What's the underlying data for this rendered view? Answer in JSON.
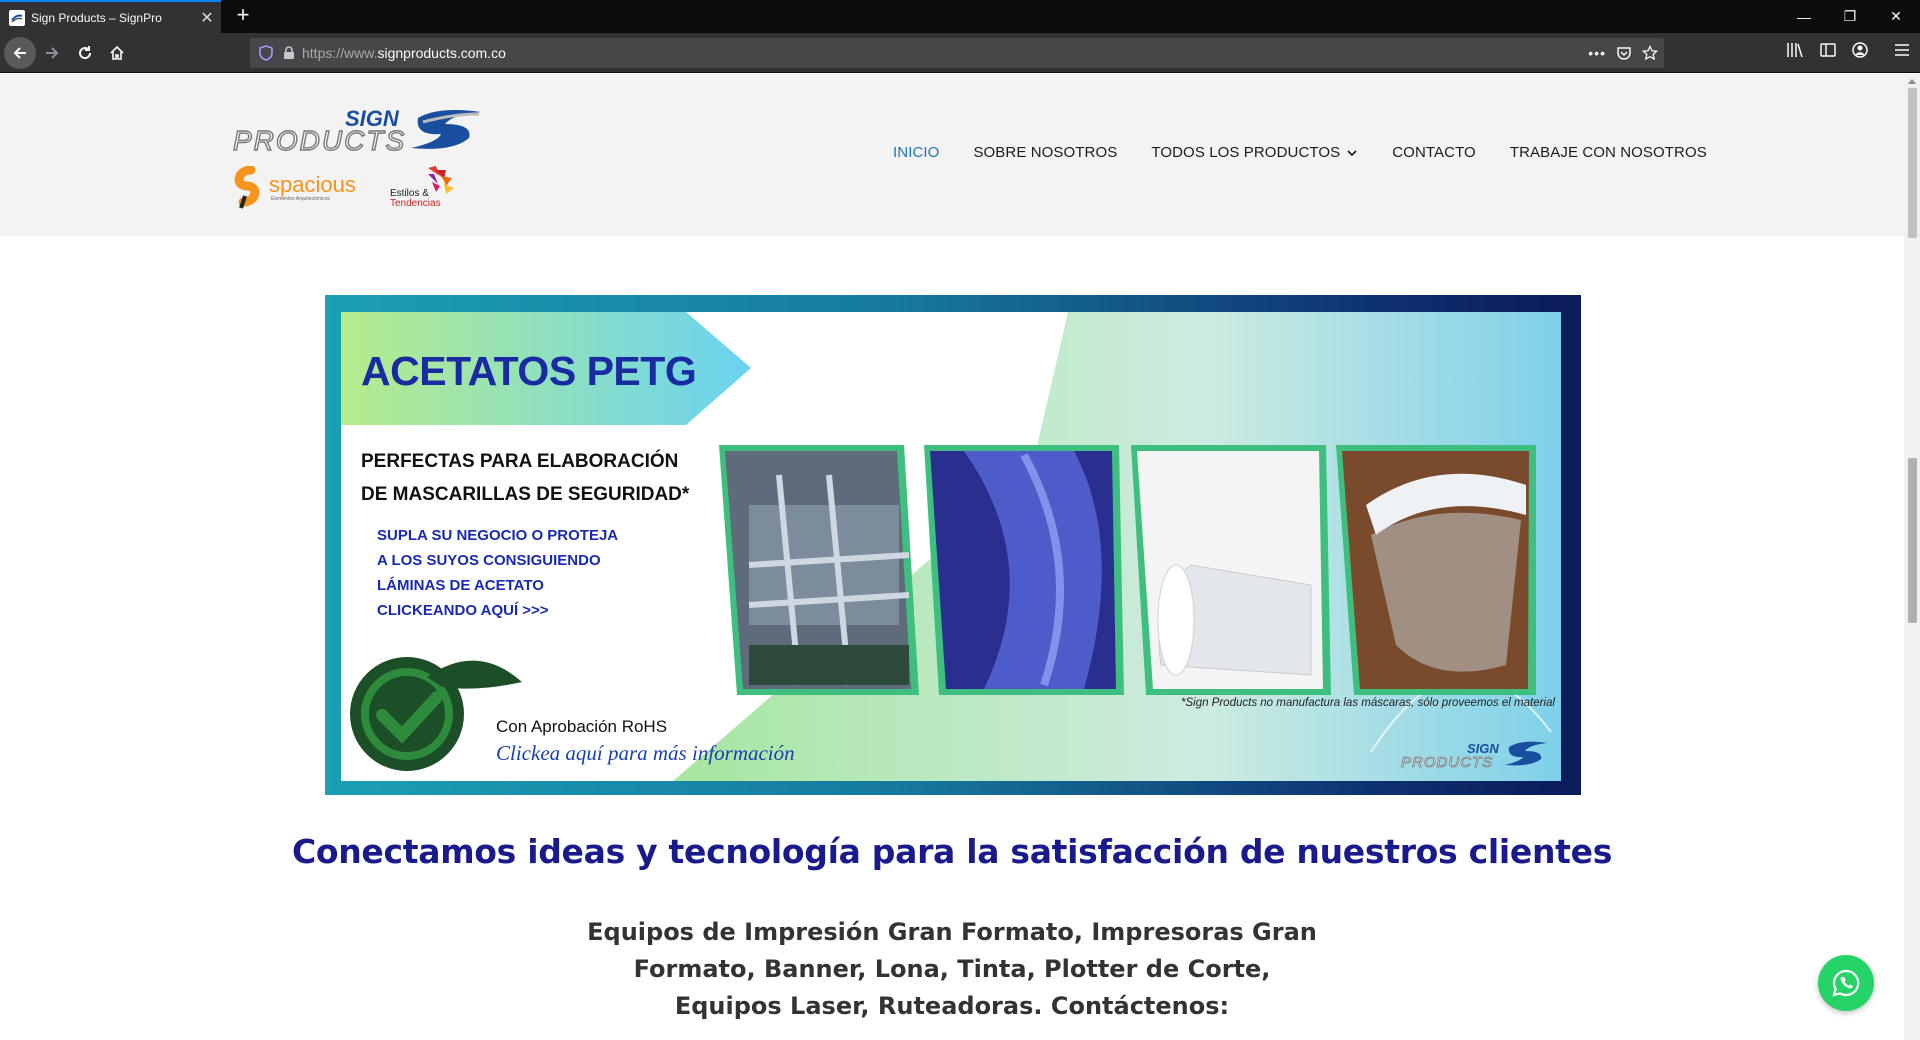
{
  "browser": {
    "tab_title": "Sign Products – SignPro",
    "url_prefix": "https://www.",
    "url_domain": "signproducts.com.co",
    "new_tab_label": "+"
  },
  "nav": {
    "items": [
      {
        "label": "INICIO",
        "active": true
      },
      {
        "label": "SOBRE NOSOTROS",
        "active": false
      },
      {
        "label": "TODOS LOS PRODUCTOS",
        "active": false
      },
      {
        "label": "CONTACTO",
        "active": false
      },
      {
        "label": "TRABAJE CON NOSOTROS",
        "active": false
      }
    ]
  },
  "logos": {
    "sign": "SIGN",
    "products": "PRODUCTS",
    "spacious": "spacious",
    "spacious_tag": "Elementos Arquitectónicos",
    "estilos": "Estilos &",
    "tendencias": "Tendencias"
  },
  "banner": {
    "title_part1": "ACETATOS ",
    "title_part2": "PETG",
    "subtitle_line1": "PERFECTAS PARA ELABORACIÓN",
    "subtitle_line2": "DE MASCARILLAS DE SEGURIDAD*",
    "cta_line1": "SUPLA SU NEGOCIO O PROTEJA",
    "cta_line2": "A LOS SUYOS CONSIGUIENDO",
    "cta_line3": "LÁMINAS DE ACETATO",
    "cta_line4": "CLICKEANDO AQUÍ >>>",
    "rohs": "Con Aprobación RoHS",
    "info_link": "Clickea aquí para más información",
    "note": "*Sign Products no manufactura las máscaras, sólo proveemos el material",
    "logo_sign": "SIGN",
    "logo_products": "PRODUCTS"
  },
  "headline": "Conectamos ideas y tecnología para la satisfacción de nuestros clientes",
  "description": "Equipos de Impresión Gran Formato, Impresoras Gran Formato, Banner, Lona, Tinta, Plotter de Corte, Equipos Laser, Ruteadoras. Contáctenos:",
  "colors": {
    "accent": "#1e73be",
    "headline": "#1a1a8c",
    "whatsapp": "#25d366"
  }
}
